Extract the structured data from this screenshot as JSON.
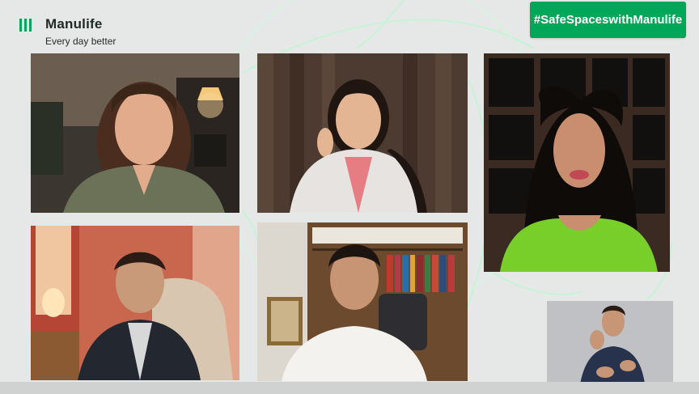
{
  "brand": {
    "name": "Manulife",
    "tagline": "Every day better",
    "logo_icon": "manulife-bars-icon",
    "accent_color": "#00a758"
  },
  "hashtag_banner": {
    "text": "#SafeSpaceswithManulife",
    "background_color": "#00a758",
    "text_color": "#ffffff"
  },
  "participants": [
    {
      "role": "host-woman-green-blouse",
      "description_icon": "person-video-icon"
    },
    {
      "role": "guest-woman-white-blazer",
      "description_icon": "person-video-icon"
    },
    {
      "role": "guest-woman-green-top",
      "description_icon": "person-video-icon"
    },
    {
      "role": "guest-man-dark-blazer",
      "description_icon": "person-video-icon"
    },
    {
      "role": "guest-man-white-shirt",
      "description_icon": "person-video-icon"
    },
    {
      "role": "sign-language-interpreter",
      "description_icon": "sign-language-icon"
    }
  ],
  "theme": {
    "background_color": "#e6e8e7",
    "ring_color": "#b6efc9"
  }
}
